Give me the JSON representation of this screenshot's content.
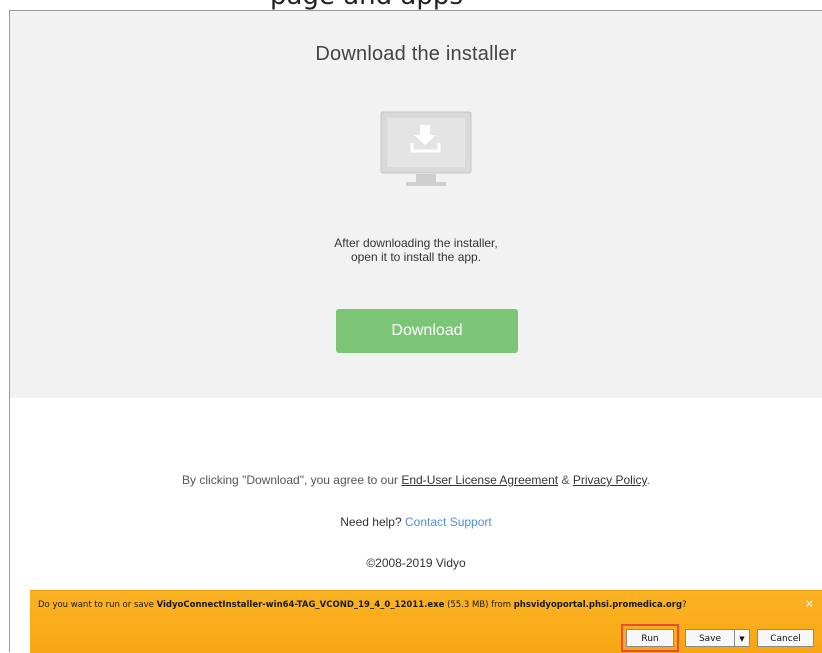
{
  "top_strip_text": "page and apps",
  "main": {
    "heading": "Download the installer",
    "instructions_line1": "After downloading the installer,",
    "instructions_line2": "open it to install the app.",
    "download_label": "Download"
  },
  "footer": {
    "legal_prefix": "By clicking \"Download\", you agree to our",
    "eula_link": "End-User License Agreement",
    "amp": "&",
    "privacy_link": "Privacy Policy",
    "period": ".",
    "help_prefix": "Need help?",
    "support_link": "Contact Support",
    "copyright": "©2008-2019 Vidyo"
  },
  "download_bar": {
    "prompt_prefix": "Do you want to run or save",
    "filename": "VidyoConnectInstaller-win64-TAG_VCOND_19_4_0_12011.exe",
    "size": "(55.3 MB) from",
    "source": "phsvidyoportal.phsi.promedica.org",
    "qmark": "?",
    "run_label": "Run",
    "save_label": "Save",
    "cancel_label": "Cancel",
    "close_glyph": "×",
    "dropdown_glyph": "▼"
  },
  "colors": {
    "download_button": "#7cc576",
    "bar_background": "#fbb324",
    "run_highlight": "#e84c3d",
    "support_link": "#4a90d9"
  },
  "icons": [
    "monitor-download-icon",
    "close-icon",
    "dropdown-arrow-icon"
  ]
}
